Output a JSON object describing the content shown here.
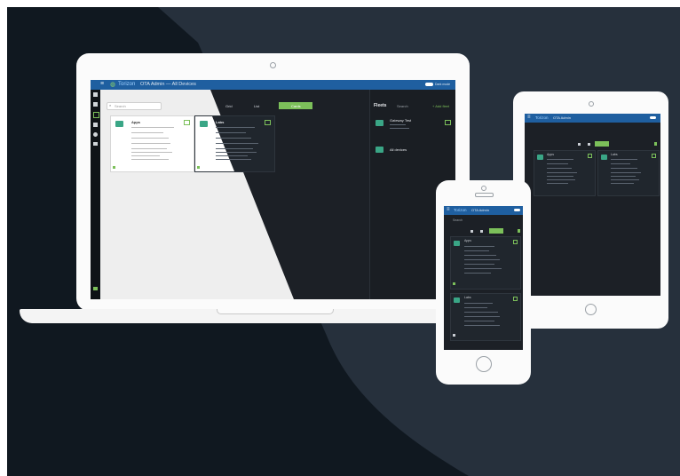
{
  "laptop": {
    "header": {
      "brand": "Torizon",
      "title": "OTA Admin  —  All Devices",
      "toggle_label": "Dark mode"
    },
    "search_placeholder": "Search",
    "cards": [
      {
        "name": "Apps",
        "lines": 8
      },
      {
        "name": "Labs",
        "lines": 8
      }
    ],
    "view_tabs": [
      "Grid",
      "List",
      "Cards"
    ],
    "fleets": {
      "title": "Fleets",
      "search_placeholder": "Search",
      "add_label": "+ Add fleet",
      "items": [
        "Gateway Test",
        "All devices"
      ]
    }
  },
  "tablet": {
    "header": {
      "brand": "Torizon",
      "title": "OTA Admin"
    },
    "cards": [
      {
        "name": "Apps"
      },
      {
        "name": "Labs"
      }
    ]
  },
  "phone": {
    "header": {
      "brand": "Torizon",
      "title": "OTA Admin"
    },
    "search_placeholder": "Search",
    "cards": [
      {
        "name": "Apps"
      },
      {
        "name": "Labs"
      }
    ]
  },
  "colors": {
    "background": "#101820",
    "accent": "#7cc05a",
    "header_blue": "#1f5fa0",
    "icon_green": "#3aa686"
  }
}
